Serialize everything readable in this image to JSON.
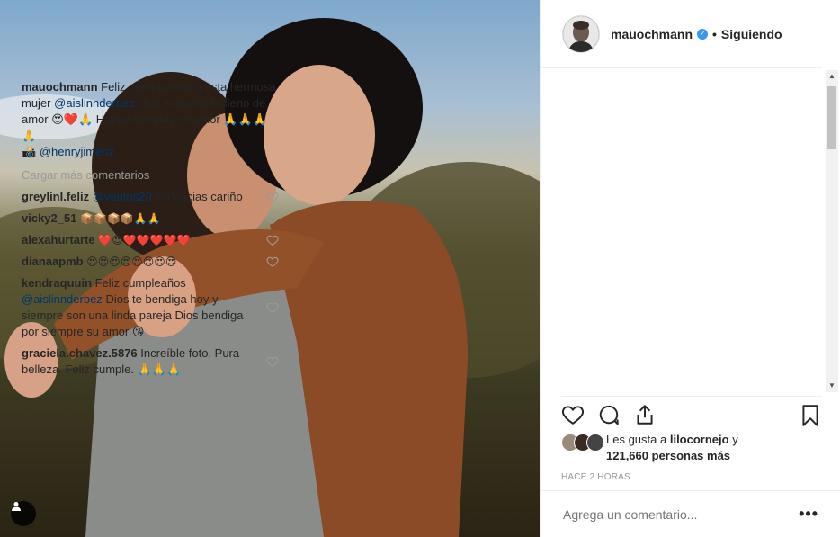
{
  "post": {
    "author": "mauochmann",
    "verified_glyph": "✓",
    "separator": "•",
    "following_label": "Siguiendo",
    "caption_author": "mauochmann",
    "caption_text_1": "Feliz cumpleaños a esta hermosa mujer",
    "caption_mention": "@aislinnderbez",
    "caption_text_2": "Que sea un año lleno de amor 😍❤️🙏 Happy birthday mi amor 🙏🙏🙏🙏",
    "credit_icon": "📸",
    "credit_mention": "@henryjimenz",
    "load_more": "Cargar más comentarios"
  },
  "comments": [
    {
      "user": "greylinl.feliz",
      "mention": "@veritos20",
      "text": "😍Gracias cariño"
    },
    {
      "user": "vicky2_51",
      "mention": "",
      "text": "📦📦📦📦🙏🙏"
    },
    {
      "user": "alexahurtarte",
      "mention": "",
      "text": "❤️😍❤️❤️❤️❤️❤️"
    },
    {
      "user": "dianaapmb",
      "mention": "",
      "text": "😍😍😍😍😍😍😍😍"
    },
    {
      "user": "kendraquuin",
      "text_before": "Feliz cumpleaños",
      "mention": "@aislinnderbez",
      "text": "Dios te bendiga hoy y siempre son una linda pareja Dios bendiga por siempre su amor 😘"
    },
    {
      "user": "graciela.chavez.5876",
      "mention": "",
      "text": "Increíble foto. Pura belleza. Feliz cumple. 🙏🙏🙏"
    }
  ],
  "likes": {
    "prefix": "Les gusta a",
    "user": "lilocornejo",
    "connector": "y",
    "count_text": "121,660 personas más"
  },
  "timestamp": "HACE 2 HORAS",
  "comment_input": {
    "placeholder": "Agrega un comentario..."
  },
  "more_options": "•••",
  "scroll": {
    "up": "▲",
    "down": "▼"
  },
  "colors": {
    "link": "#003569",
    "muted": "#999999",
    "verified": "#3897f0",
    "heart": "#ed4956"
  }
}
